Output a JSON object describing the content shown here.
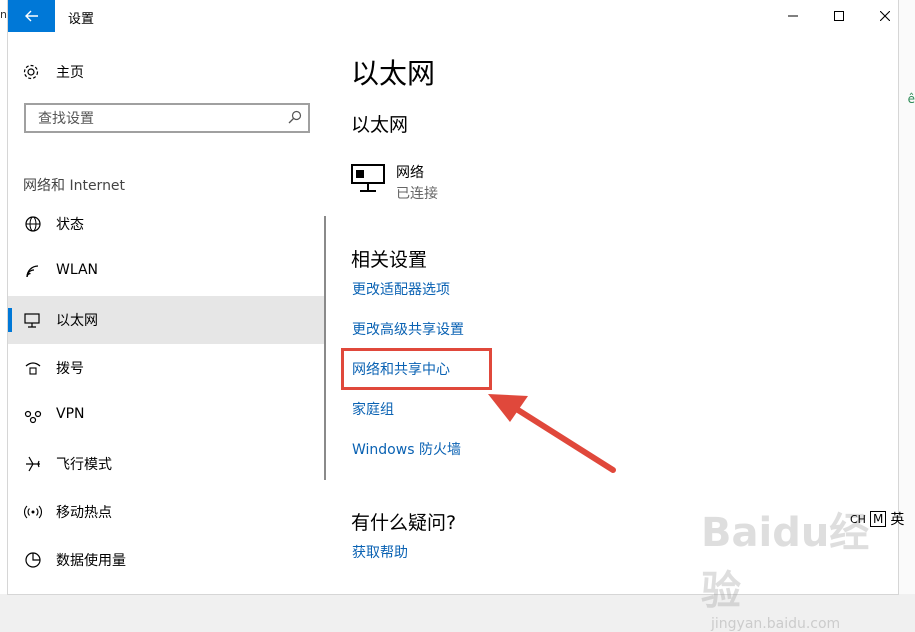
{
  "window": {
    "title": "设置"
  },
  "sidebar": {
    "home_label": "主页",
    "search_placeholder": "查找设置",
    "section_title": "网络和 Internet",
    "items": [
      {
        "label": "状态",
        "icon": "globe-icon"
      },
      {
        "label": "WLAN",
        "icon": "wifi-icon"
      },
      {
        "label": "以太网",
        "icon": "ethernet-icon",
        "selected": true
      },
      {
        "label": "拨号",
        "icon": "dialup-icon"
      },
      {
        "label": "VPN",
        "icon": "vpn-icon"
      },
      {
        "label": "飞行模式",
        "icon": "airplane-icon"
      },
      {
        "label": "移动热点",
        "icon": "hotspot-icon"
      },
      {
        "label": "数据使用量",
        "icon": "data-usage-icon"
      }
    ]
  },
  "main": {
    "page_title": "以太网",
    "subtitle": "以太网",
    "network": {
      "name": "网络",
      "status": "已连接"
    },
    "related_title": "相关设置",
    "links": [
      "更改适配器选项",
      "更改高级共享设置",
      "网络和共享中心",
      "家庭组",
      "Windows 防火墙"
    ],
    "help_title": "有什么疑问?",
    "help_link": "获取帮助"
  },
  "ime": {
    "lang": "CH",
    "mode": "M",
    "input": "英"
  },
  "watermark": {
    "logo": "Baidu经验",
    "url": "jingyan.baidu.com"
  },
  "colors": {
    "accent": "#0078d7",
    "link": "#0a62b3",
    "highlight": "#e0483b"
  }
}
